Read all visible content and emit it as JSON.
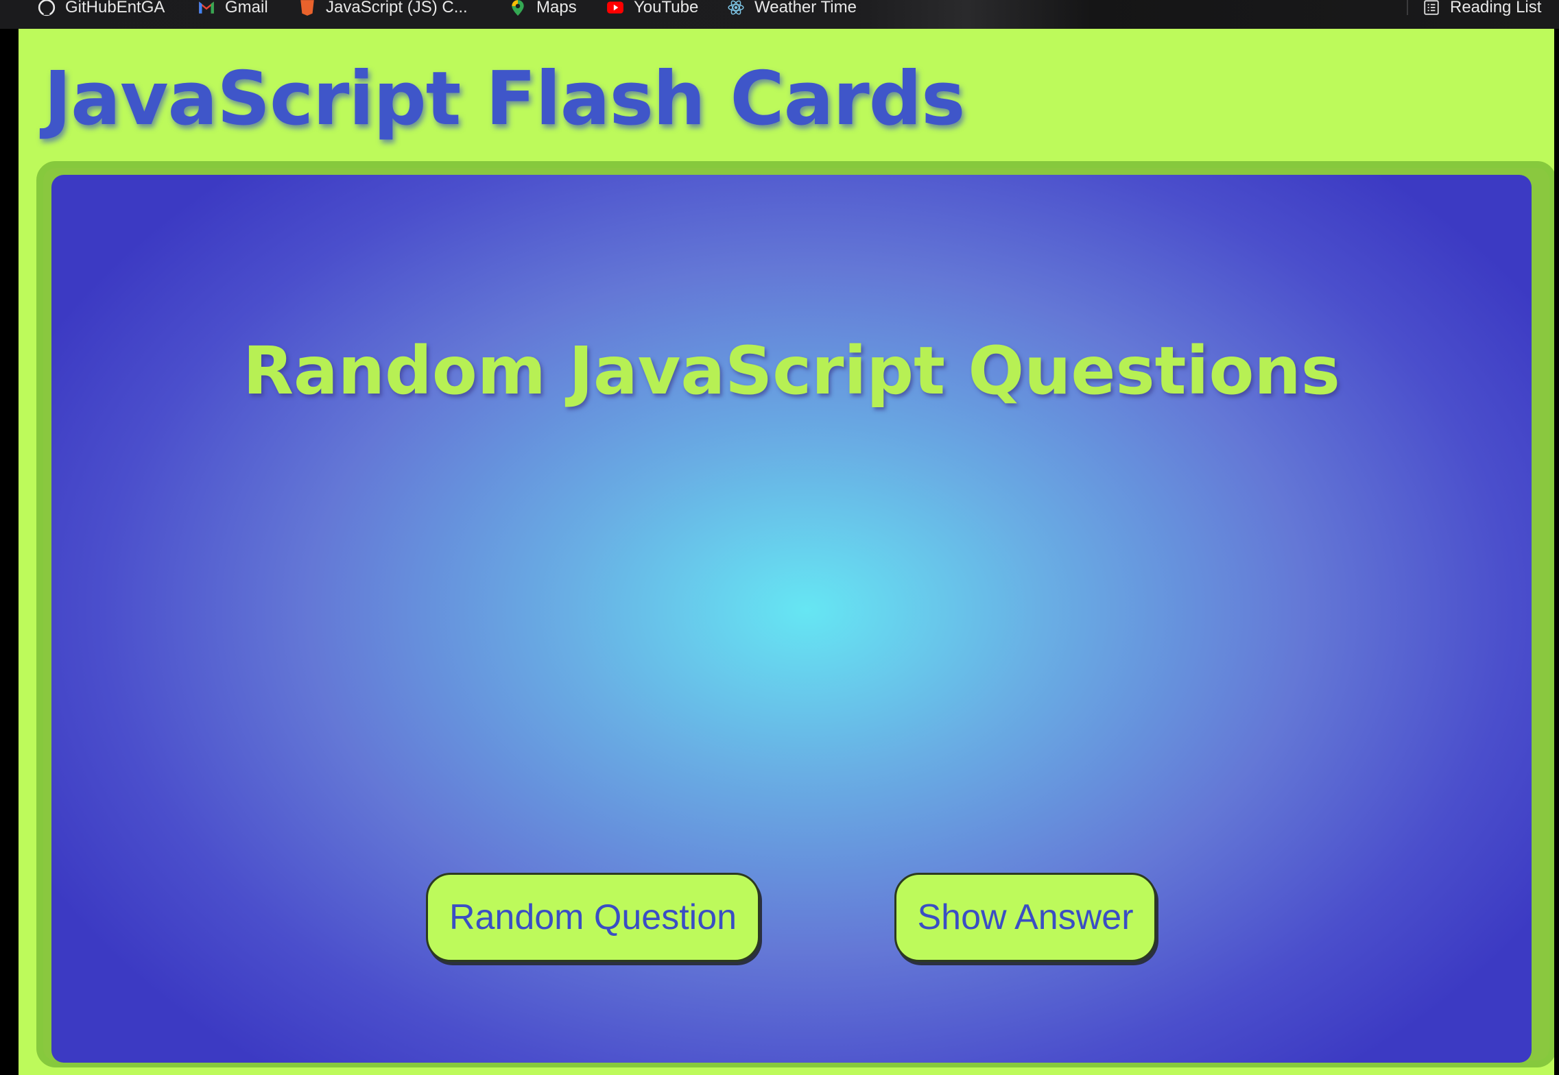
{
  "bookmarks": {
    "items": [
      {
        "label": "GitHubEntGA",
        "icon": "github-icon"
      },
      {
        "label": "Gmail",
        "icon": "gmail-icon"
      },
      {
        "label": "JavaScript (JS) C...",
        "icon": "html5-icon"
      },
      {
        "label": "Maps",
        "icon": "maps-pin-icon"
      },
      {
        "label": "YouTube",
        "icon": "youtube-icon"
      },
      {
        "label": "Weather Time",
        "icon": "react-icon"
      }
    ],
    "reading_list": {
      "label": "Reading List",
      "icon": "reading-list-icon"
    }
  },
  "page": {
    "title": "JavaScript Flash Cards",
    "card": {
      "heading": "Random JavaScript Questions",
      "random_button": "Random Question",
      "answer_button": "Show Answer"
    }
  },
  "colors": {
    "page_background": "#bdfa5b",
    "title_blue": "#3f56c9",
    "card_center": "#66e6f3",
    "card_edge": "#3c3ac3",
    "heading_green": "#b7f054",
    "frame_green": "#86c93d"
  }
}
